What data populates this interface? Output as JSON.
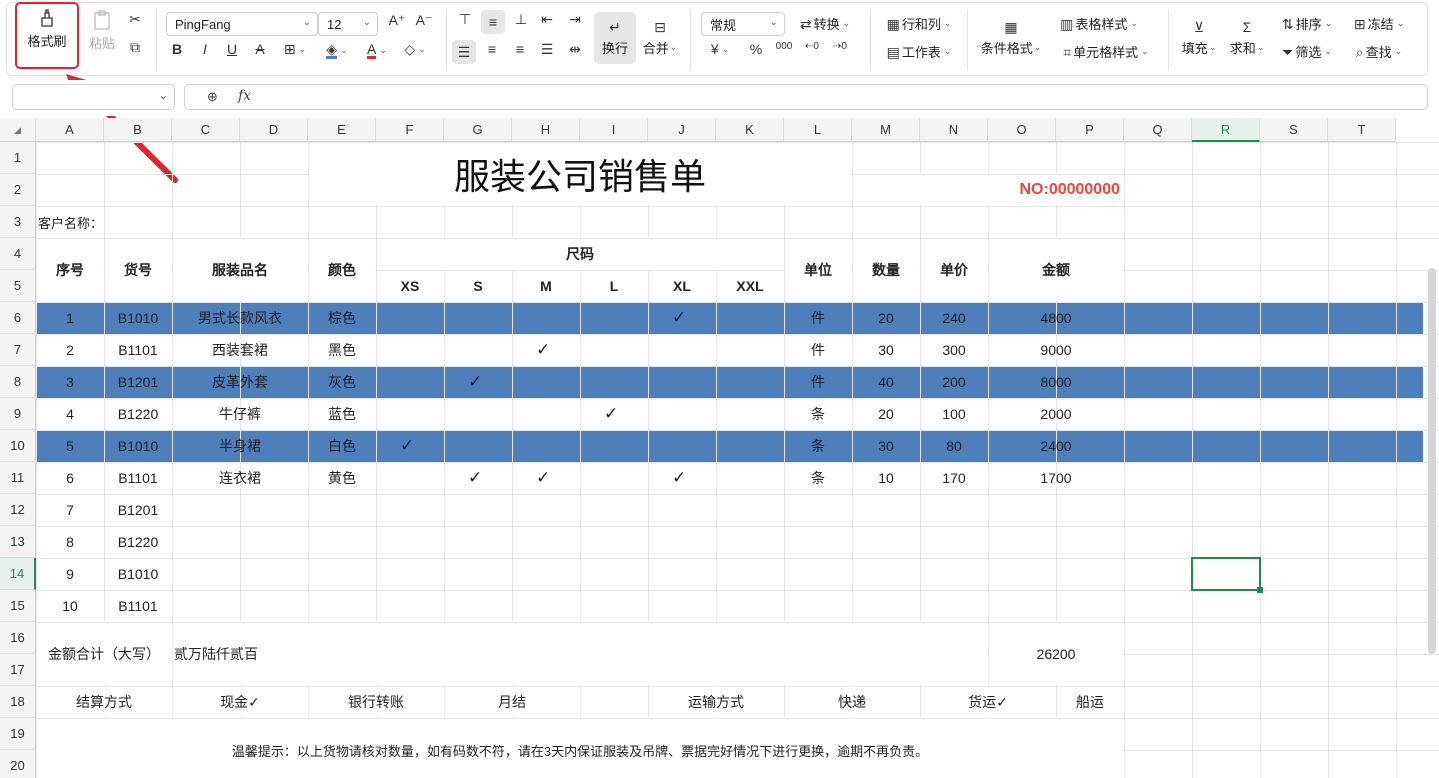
{
  "ribbon": {
    "format_painter": "格式刷",
    "paste": "粘贴",
    "font_name": "PingFang",
    "font_size": "12",
    "wrap": "换行",
    "merge": "合并",
    "number_format": "常规",
    "convert": "转换",
    "rows_cols": "行和列",
    "worksheet": "工作表",
    "cond_format": "条件格式",
    "table_style": "表格样式",
    "cell_style": "单元格样式",
    "fill": "填充",
    "sum": "求和",
    "sort": "排序",
    "filter": "筛选",
    "freeze": "冻结",
    "find": "查找",
    "currency": "¥",
    "percent": "%",
    "thousands": "000"
  },
  "formula_bar": {
    "name_box": "",
    "fx": "fx",
    "content": ""
  },
  "columns": [
    "A",
    "B",
    "C",
    "D",
    "E",
    "F",
    "G",
    "H",
    "I",
    "J",
    "K",
    "L",
    "M",
    "N",
    "O",
    "P",
    "Q",
    "R",
    "S",
    "T"
  ],
  "rows": [
    "1",
    "2",
    "3",
    "4",
    "5",
    "6",
    "7",
    "8",
    "9",
    "10",
    "11",
    "12",
    "13",
    "14",
    "15",
    "16",
    "17",
    "18",
    "19",
    "20"
  ],
  "sheet": {
    "title": "服装公司销售单",
    "number": "NO:00000000",
    "customer_label": "客户名称：",
    "headers": {
      "seq": "序号",
      "code": "货号",
      "name": "服装品名",
      "color": "颜色",
      "size": "尺码",
      "unit": "单位",
      "qty": "数量",
      "price": "单价",
      "amount": "金额",
      "xs": "XS",
      "s": "S",
      "m": "M",
      "l": "L",
      "xl": "XL",
      "xxl": "XXL"
    },
    "items": [
      {
        "seq": "1",
        "code": "B1010",
        "name": "男式长款风衣",
        "color": "棕色",
        "sizes": [
          "",
          "",
          "",
          "",
          "✓",
          ""
        ],
        "unit": "件",
        "qty": "20",
        "price": "240",
        "amount": "4800",
        "shaded": true
      },
      {
        "seq": "2",
        "code": "B1101",
        "name": "西装套裙",
        "color": "黑色",
        "sizes": [
          "",
          "",
          "✓",
          "",
          "",
          ""
        ],
        "unit": "件",
        "qty": "30",
        "price": "300",
        "amount": "9000",
        "shaded": false
      },
      {
        "seq": "3",
        "code": "B1201",
        "name": "皮革外套",
        "color": "灰色",
        "sizes": [
          "",
          "✓",
          "",
          "",
          "",
          ""
        ],
        "unit": "件",
        "qty": "40",
        "price": "200",
        "amount": "8000",
        "shaded": true
      },
      {
        "seq": "4",
        "code": "B1220",
        "name": "牛仔裤",
        "color": "蓝色",
        "sizes": [
          "",
          "",
          "",
          "✓",
          "",
          ""
        ],
        "unit": "条",
        "qty": "20",
        "price": "100",
        "amount": "2000",
        "shaded": false
      },
      {
        "seq": "5",
        "code": "B1010",
        "name": "半身裙",
        "color": "白色",
        "sizes": [
          "✓",
          "",
          "",
          "",
          "",
          ""
        ],
        "unit": "条",
        "qty": "30",
        "price": "80",
        "amount": "2400",
        "shaded": true
      },
      {
        "seq": "6",
        "code": "B1101",
        "name": "连衣裙",
        "color": "黄色",
        "sizes": [
          "",
          "✓",
          "✓",
          "",
          "✓",
          ""
        ],
        "unit": "条",
        "qty": "10",
        "price": "170",
        "amount": "1700",
        "shaded": false
      },
      {
        "seq": "7",
        "code": "B1201"
      },
      {
        "seq": "8",
        "code": "B1220"
      },
      {
        "seq": "9",
        "code": "B1010"
      },
      {
        "seq": "10",
        "code": "B1101"
      }
    ],
    "total_label": "金额合计（大写）",
    "total_words": "贰万陆仟贰百",
    "total_value": "26200",
    "settle_label": "结算方式",
    "cash": "现金✓",
    "bank": "银行转账",
    "monthly": "月结",
    "ship_label": "运输方式",
    "express": "快递",
    "freight": "货运✓",
    "sea": "船运",
    "note": "温馨提示：以上货物请核对数量，如有码数不符，请在3天内保证服装及吊牌、票据完好情况下进行更换，逾期不再负责。"
  },
  "colors": {
    "band": "#4e7fba",
    "number_red": "#e8483e",
    "highlight": "#e0242c",
    "selection": "#1e8e4e"
  }
}
